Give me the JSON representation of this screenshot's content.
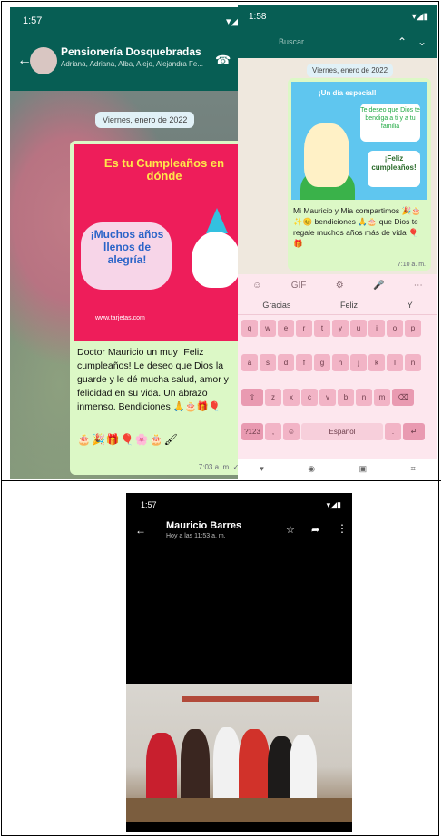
{
  "shot1": {
    "status_time": "1:57",
    "status_right": "▾◢▮",
    "group_name": "Pensionería Dosquebradas",
    "group_members": "Adriana, Adriana, Alba, Alejo, Alejandra Fe...",
    "date_chip": "Viernes, enero de 2022",
    "card_heading": "Es tu Cumpleaños en dónde",
    "card_line1": "¡Muchos años",
    "card_line2": "llenos de",
    "card_line3": "alegría!",
    "card_footer": "www.tarjetas.com",
    "message": "Doctor Mauricio un muy ¡Feliz cumpleaños! Le deseo que Dios la guarde y le dé mucha salud, amor y felicidad en su vida. Un abrazo inmenso. Bendiciones 🙏🎂🎁🎈",
    "emojis": "🎂🎉🎁🎈🌸🎂🖌",
    "time": "7:03 a. m. ✓✓"
  },
  "shot2": {
    "status_time": "1:58",
    "status_right": "▾◢▮",
    "search_placeholder": "Buscar...",
    "date_chip": "Viernes, enero de 2022",
    "card_title": "¡Un día especial!",
    "card_box1": "Te deseo que Dios te bendiga a ti y a tu familia",
    "card_box2": "¡Feliz cumpleaños!",
    "message": "Mi Mauricio y Mia compartimos 🎉🎂 ✨😊 bendiciones 🙏🎂 que Dios te regale muchos años más de vida 🎈🎁",
    "time": "7:10 a. m.",
    "suggestions": [
      "Gracias",
      "Feliz",
      "Y"
    ],
    "tools": [
      "☺",
      "GIF",
      "⚙",
      "🎤",
      "⋯"
    ],
    "rows": [
      [
        "q",
        "w",
        "e",
        "r",
        "t",
        "y",
        "u",
        "i",
        "o",
        "p"
      ],
      [
        "a",
        "s",
        "d",
        "f",
        "g",
        "h",
        "j",
        "k",
        "l",
        "ñ"
      ],
      [
        "⇧",
        "z",
        "x",
        "c",
        "v",
        "b",
        "n",
        "m",
        "⌫"
      ],
      [
        "?123",
        ",",
        "☺",
        "Español",
        ".",
        "↵"
      ]
    ],
    "nav": [
      "▾",
      "◉",
      "▣",
      "⌗"
    ]
  },
  "shot3": {
    "status_time": "1:57",
    "status_right": "▾◢▮",
    "name": "Mauricio Barres",
    "sub": "Hoy a las 11:53 a. m.",
    "icons": [
      "star-icon",
      "share-icon",
      "menu-icon"
    ]
  }
}
